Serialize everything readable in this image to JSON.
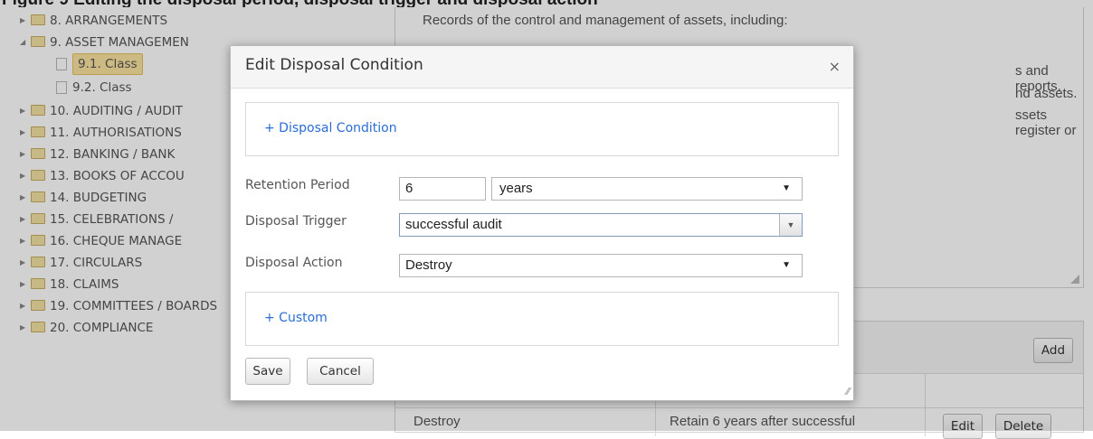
{
  "top_fragment": "Figure 9 Editing the disposal period, disposal trigger and disposal action",
  "tree": {
    "items": [
      {
        "label": "8. ARRANGEMENTS",
        "type": "folder",
        "arrow": "▶"
      },
      {
        "label": "9. ASSET MANAGEMEN",
        "type": "folder",
        "arrow": "◢"
      },
      {
        "label": "9.1. Class",
        "type": "doc",
        "selected": true
      },
      {
        "label": "9.2. Class",
        "type": "doc"
      },
      {
        "label": "10. AUDITING / AUDIT",
        "type": "folder",
        "arrow": "▶"
      },
      {
        "label": "11. AUTHORISATIONS",
        "type": "folder",
        "arrow": "▶"
      },
      {
        "label": "12. BANKING / BANK",
        "type": "folder",
        "arrow": "▶"
      },
      {
        "label": "13. BOOKS OF ACCOU",
        "type": "folder",
        "arrow": "▶"
      },
      {
        "label": "14. BUDGETING",
        "type": "folder",
        "arrow": "▶"
      },
      {
        "label": "15. CELEBRATIONS /",
        "type": "folder",
        "arrow": "▶"
      },
      {
        "label": "16. CHEQUE MANAGE",
        "type": "folder",
        "arrow": "▶"
      },
      {
        "label": "17. CIRCULARS",
        "type": "folder",
        "arrow": "▶"
      },
      {
        "label": "18. CLAIMS",
        "type": "folder",
        "arrow": "▶"
      },
      {
        "label": "19. COMMITTEES / BOARDS",
        "type": "folder",
        "arrow": "▶"
      },
      {
        "label": "20. COMPLIANCE",
        "type": "folder",
        "arrow": "▶"
      }
    ]
  },
  "description": {
    "lines": [
      "Records of the control and management of assets, including:",
      "s and reports.",
      "nd assets.",
      "ssets register or"
    ]
  },
  "conditions_table": {
    "add_label": "Add",
    "row": {
      "action": "Destroy",
      "condition": "Retain 6 years after successful",
      "edit_label": "Edit",
      "delete_label": "Delete"
    }
  },
  "dialog": {
    "title": "Edit Disposal Condition",
    "close_glyph": "×",
    "disposal_condition_link": "+ Disposal Condition",
    "retention_label": "Retention Period",
    "retention_value": "6",
    "retention_unit": "years",
    "trigger_label": "Disposal Trigger",
    "trigger_value": "successful audit",
    "action_label": "Disposal Action",
    "action_value": "Destroy",
    "custom_link": "+ Custom",
    "save_label": "Save",
    "cancel_label": "Cancel"
  }
}
